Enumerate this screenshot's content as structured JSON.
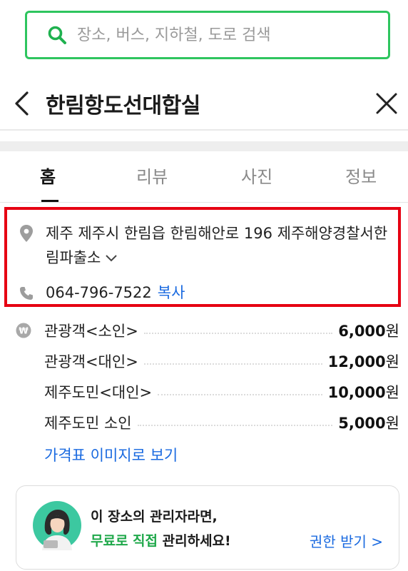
{
  "search": {
    "placeholder": "장소, 버스, 지하철, 도로 검색"
  },
  "header": {
    "title": "한림항도선대합실"
  },
  "tabs": [
    {
      "label": "홈",
      "active": true
    },
    {
      "label": "리뷰",
      "active": false
    },
    {
      "label": "사진",
      "active": false
    },
    {
      "label": "정보",
      "active": false
    }
  ],
  "info": {
    "address": "제주 제주시 한림읍 한림해안로 196 제주해양경찰서한림파출소",
    "phone": "064-796-7522",
    "copy_label": "복사"
  },
  "prices": {
    "rows": [
      {
        "name": "관광객<소인>",
        "amount": "6,000",
        "unit": "원"
      },
      {
        "name": "관광객<대인>",
        "amount": "12,000",
        "unit": "원"
      },
      {
        "name": "제주도민<대인>",
        "amount": "10,000",
        "unit": "원"
      },
      {
        "name": "제주도민 소인",
        "amount": "5,000",
        "unit": "원"
      }
    ],
    "image_link": "가격표 이미지로 보기"
  },
  "banner": {
    "line1": "이 장소의 관리자라면,",
    "line2_highlight": "무료로 직접",
    "line2_rest": " 관리하세요!",
    "action": "권한 받기 >"
  },
  "colors": {
    "accent_green": "#2ec55f",
    "link_blue": "#1a6ae0",
    "highlight_red": "#e60012"
  }
}
